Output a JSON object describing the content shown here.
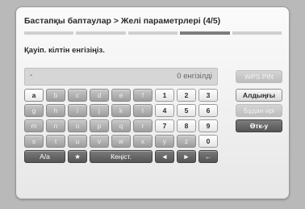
{
  "dialog": {
    "breadcrumb": "Бастапқы баптаулар > Желі параметрлері (4/5)",
    "step_count": 5,
    "active_step": 4,
    "prompt": "Қауіп. кілтін енгізіңіз.",
    "input_value": "-",
    "char_count": "0 енгізілді"
  },
  "keyboard": {
    "row1": [
      "a",
      "b",
      "c",
      "d",
      "e",
      "f",
      "1",
      "2",
      "3"
    ],
    "row2": [
      "g",
      "h",
      "i",
      "j",
      "k",
      "l",
      "4",
      "5",
      "6"
    ],
    "row3": [
      "m",
      "n",
      "o",
      "p",
      "q",
      "r",
      "7",
      "8",
      "9"
    ],
    "row4": [
      "s",
      "t",
      "u",
      "v",
      "w",
      "x",
      "y",
      "z",
      "0"
    ],
    "row5": [
      "A/a",
      "★",
      "Кеңіст.",
      "◄",
      "►",
      "←"
    ]
  },
  "side_buttons": {
    "wps_pin": "WPS PIN",
    "previous": "Алдыңғы",
    "next": "Бұдан әрі",
    "cancel": "Өтк-у"
  }
}
